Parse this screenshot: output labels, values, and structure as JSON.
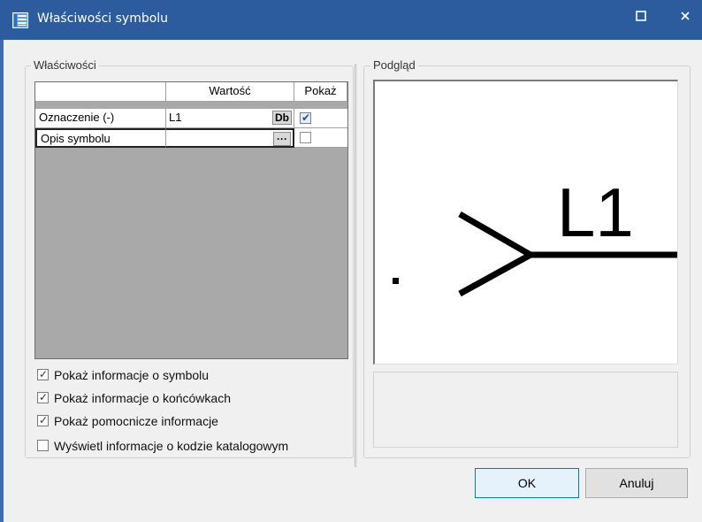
{
  "window": {
    "title": "Właściwości symbolu"
  },
  "properties": {
    "legend": "Właściwości",
    "columns": [
      "",
      "Wartość",
      "Pokaż"
    ],
    "rows": [
      {
        "name": "Oznaczenie (-)",
        "value": "L1",
        "button": "Db",
        "show": true
      },
      {
        "name": "Opis symbolu",
        "value": "",
        "button": "···",
        "show": false
      }
    ],
    "options": [
      {
        "label": "Pokaż informacje o symbolu",
        "checked": true
      },
      {
        "label": "Pokaż informacje o końcówkach",
        "checked": true
      },
      {
        "label": "Pokaż pomocnicze informacje",
        "checked": true
      },
      {
        "label": "Wyświetl informacje o kodzie katalogowym",
        "checked": false
      }
    ]
  },
  "preview": {
    "legend": "Podgląd",
    "symbol_label": "L1"
  },
  "buttons": {
    "ok": "OK",
    "cancel": "Anuluj"
  },
  "colors": {
    "titlebar": "#2d5c9e",
    "accent": "#0078d7"
  }
}
